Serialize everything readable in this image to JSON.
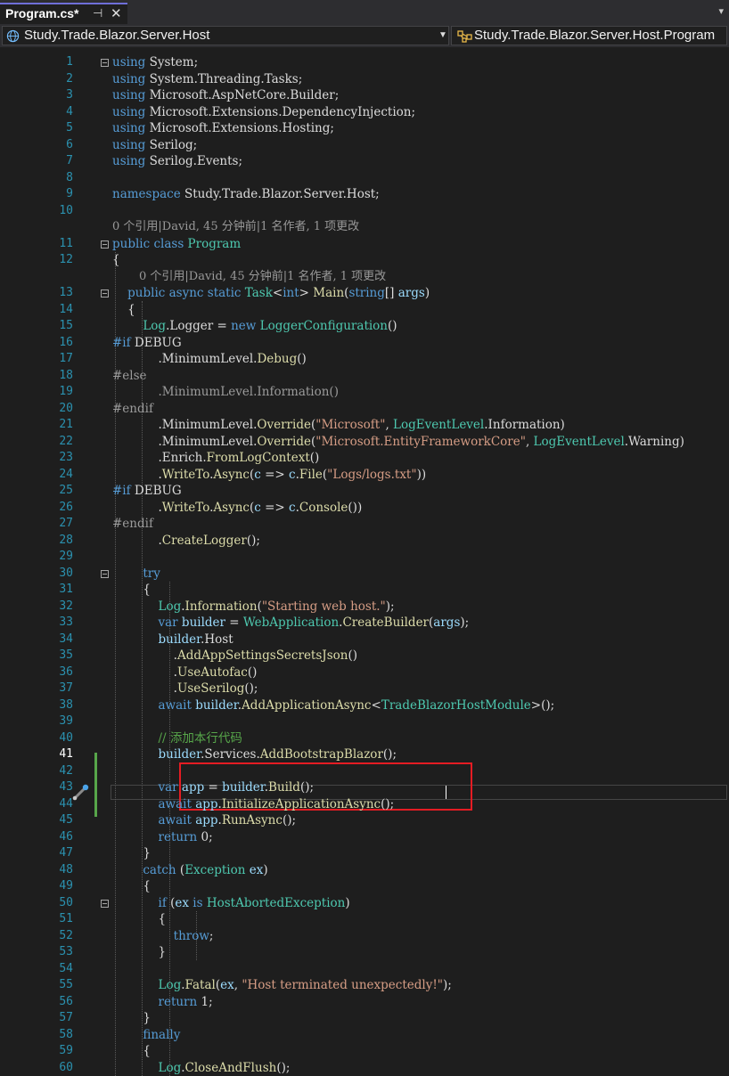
{
  "tab": {
    "title": "Program.cs*"
  },
  "nav": {
    "project": "Study.Trade.Blazor.Server.Host",
    "member": "Study.Trade.Blazor.Server.Host.Program"
  },
  "lenses": [
    "0 个引用|David, 45 分钟前|1 名作者, 1 项更改",
    "0 个引用|David, 45 分钟前|1 名作者, 1 项更改"
  ],
  "lines": [
    {
      "n": "1",
      "t": [
        [
          "k",
          "using"
        ],
        [
          "p",
          " System;"
        ]
      ]
    },
    {
      "n": "2",
      "t": [
        [
          "k",
          "using"
        ],
        [
          "p",
          " System.Threading.Tasks;"
        ]
      ]
    },
    {
      "n": "3",
      "t": [
        [
          "k",
          "using"
        ],
        [
          "p",
          " Microsoft.AspNetCore.Builder;"
        ]
      ]
    },
    {
      "n": "4",
      "t": [
        [
          "k",
          "using"
        ],
        [
          "p",
          " Microsoft.Extensions.DependencyInjection;"
        ]
      ]
    },
    {
      "n": "5",
      "t": [
        [
          "k",
          "using"
        ],
        [
          "p",
          " Microsoft.Extensions.Hosting;"
        ]
      ]
    },
    {
      "n": "6",
      "t": [
        [
          "k",
          "using"
        ],
        [
          "p",
          " Serilog;"
        ]
      ]
    },
    {
      "n": "7",
      "t": [
        [
          "k",
          "using"
        ],
        [
          "p",
          " Serilog.Events;"
        ]
      ]
    },
    {
      "n": "8",
      "t": []
    },
    {
      "n": "9",
      "t": [
        [
          "k",
          "namespace"
        ],
        [
          "p",
          " Study.Trade.Blazor.Server.Host;"
        ]
      ]
    },
    {
      "n": "10",
      "t": []
    },
    {
      "n": "11",
      "t": [
        [
          "k",
          "public class "
        ],
        [
          "t",
          "Program"
        ]
      ]
    },
    {
      "n": "12",
      "t": [
        [
          "p",
          "{"
        ]
      ]
    },
    {
      "n": "13",
      "t": [
        [
          "k",
          "    public async static "
        ],
        [
          "t",
          "Task"
        ],
        [
          "p",
          "<"
        ],
        [
          "k",
          "int"
        ],
        [
          "p",
          "> "
        ],
        [
          "m",
          "Main"
        ],
        [
          "p",
          "("
        ],
        [
          "k",
          "string"
        ],
        [
          "p",
          "[] "
        ],
        [
          "v",
          "args"
        ],
        [
          "p",
          ")"
        ]
      ]
    },
    {
      "n": "14",
      "t": [
        [
          "p",
          "    {"
        ]
      ]
    },
    {
      "n": "15",
      "t": [
        [
          "p",
          "        "
        ],
        [
          "t",
          "Log"
        ],
        [
          "p",
          "."
        ],
        [
          "p",
          "Logger = "
        ],
        [
          "k",
          "new "
        ],
        [
          "t",
          "LoggerConfiguration"
        ],
        [
          "p",
          "()"
        ]
      ]
    },
    {
      "n": "16",
      "t": [
        [
          "k",
          "#if"
        ],
        [
          "p",
          " DEBUG"
        ]
      ]
    },
    {
      "n": "17",
      "t": [
        [
          "p",
          "            ."
        ],
        [
          "p",
          "MinimumLevel."
        ],
        [
          "m",
          "Debug"
        ],
        [
          "p",
          "()"
        ]
      ]
    },
    {
      "n": "18",
      "t": [
        [
          "g",
          "#else"
        ]
      ]
    },
    {
      "n": "19",
      "t": [
        [
          "g",
          "            .MinimumLevel.Information()"
        ]
      ]
    },
    {
      "n": "20",
      "t": [
        [
          "g",
          "#endif"
        ]
      ]
    },
    {
      "n": "21",
      "t": [
        [
          "p",
          "            .MinimumLevel."
        ],
        [
          "m",
          "Override"
        ],
        [
          "p",
          "("
        ],
        [
          "s",
          "\"Microsoft\""
        ],
        [
          "p",
          ", "
        ],
        [
          "t",
          "LogEventLevel"
        ],
        [
          "p",
          ".Information)"
        ]
      ]
    },
    {
      "n": "22",
      "t": [
        [
          "p",
          "            .MinimumLevel."
        ],
        [
          "m",
          "Override"
        ],
        [
          "p",
          "("
        ],
        [
          "s",
          "\"Microsoft.EntityFrameworkCore\""
        ],
        [
          "p",
          ", "
        ],
        [
          "t",
          "LogEventLevel"
        ],
        [
          "p",
          ".Warning)"
        ]
      ]
    },
    {
      "n": "23",
      "t": [
        [
          "p",
          "            .Enrich."
        ],
        [
          "m",
          "FromLogContext"
        ],
        [
          "p",
          "()"
        ]
      ]
    },
    {
      "n": "24",
      "t": [
        [
          "p",
          "            ."
        ],
        [
          "m",
          "WriteTo"
        ],
        [
          "p",
          "."
        ],
        [
          "m",
          "Async"
        ],
        [
          "p",
          "("
        ],
        [
          "v",
          "c"
        ],
        [
          "p",
          " => "
        ],
        [
          "v",
          "c"
        ],
        [
          "p",
          "."
        ],
        [
          "m",
          "File"
        ],
        [
          "p",
          "("
        ],
        [
          "s",
          "\"Logs/logs.txt\""
        ],
        [
          "p",
          "))"
        ]
      ]
    },
    {
      "n": "25",
      "t": [
        [
          "k",
          "#if"
        ],
        [
          "p",
          " DEBUG"
        ]
      ]
    },
    {
      "n": "26",
      "t": [
        [
          "p",
          "            ."
        ],
        [
          "m",
          "WriteTo"
        ],
        [
          "p",
          "."
        ],
        [
          "m",
          "Async"
        ],
        [
          "p",
          "("
        ],
        [
          "v",
          "c"
        ],
        [
          "p",
          " => "
        ],
        [
          "v",
          "c"
        ],
        [
          "p",
          "."
        ],
        [
          "m",
          "Console"
        ],
        [
          "p",
          "())"
        ]
      ]
    },
    {
      "n": "27",
      "t": [
        [
          "g",
          "#endif"
        ]
      ]
    },
    {
      "n": "28",
      "t": [
        [
          "p",
          "            ."
        ],
        [
          "m",
          "CreateLogger"
        ],
        [
          "p",
          "();"
        ]
      ]
    },
    {
      "n": "29",
      "t": []
    },
    {
      "n": "30",
      "t": [
        [
          "k",
          "        try"
        ]
      ]
    },
    {
      "n": "31",
      "t": [
        [
          "p",
          "        {"
        ]
      ]
    },
    {
      "n": "32",
      "t": [
        [
          "p",
          "            "
        ],
        [
          "t",
          "Log"
        ],
        [
          "p",
          "."
        ],
        [
          "m",
          "Information"
        ],
        [
          "p",
          "("
        ],
        [
          "s",
          "\"Starting web host.\""
        ],
        [
          "p",
          ");"
        ]
      ]
    },
    {
      "n": "33",
      "t": [
        [
          "k",
          "            var "
        ],
        [
          "v",
          "builder"
        ],
        [
          "p",
          " = "
        ],
        [
          "t",
          "WebApplication"
        ],
        [
          "p",
          "."
        ],
        [
          "m",
          "CreateBuilder"
        ],
        [
          "p",
          "("
        ],
        [
          "v",
          "args"
        ],
        [
          "p",
          ");"
        ]
      ]
    },
    {
      "n": "34",
      "t": [
        [
          "p",
          "            "
        ],
        [
          "v",
          "builder"
        ],
        [
          "p",
          ".Host"
        ]
      ]
    },
    {
      "n": "35",
      "t": [
        [
          "p",
          "                ."
        ],
        [
          "m",
          "AddAppSettingsSecretsJson"
        ],
        [
          "p",
          "()"
        ]
      ]
    },
    {
      "n": "36",
      "t": [
        [
          "p",
          "                ."
        ],
        [
          "m",
          "UseAutofac"
        ],
        [
          "p",
          "()"
        ]
      ]
    },
    {
      "n": "37",
      "t": [
        [
          "p",
          "                ."
        ],
        [
          "m",
          "UseSerilog"
        ],
        [
          "p",
          "();"
        ]
      ]
    },
    {
      "n": "38",
      "t": [
        [
          "k",
          "            await "
        ],
        [
          "v",
          "builder"
        ],
        [
          "p",
          "."
        ],
        [
          "m",
          "AddApplicationAsync"
        ],
        [
          "p",
          "<"
        ],
        [
          "t",
          "TradeBlazorHostModule"
        ],
        [
          "p",
          ">();"
        ]
      ]
    },
    {
      "n": "39",
      "t": []
    },
    {
      "n": "40",
      "t": [
        [
          "c",
          "            // 添加本行代码"
        ]
      ]
    },
    {
      "n": "41",
      "t": [
        [
          "p",
          "            "
        ],
        [
          "v",
          "builder"
        ],
        [
          "p",
          ".Services."
        ],
        [
          "m",
          "AddBootstrapBlazor"
        ],
        [
          "p",
          "();"
        ]
      ]
    },
    {
      "n": "42",
      "t": []
    },
    {
      "n": "43",
      "t": [
        [
          "k",
          "            var "
        ],
        [
          "v",
          "app"
        ],
        [
          "p",
          " = "
        ],
        [
          "v",
          "builder"
        ],
        [
          "p",
          "."
        ],
        [
          "m",
          "Build"
        ],
        [
          "p",
          "();"
        ]
      ]
    },
    {
      "n": "44",
      "t": [
        [
          "k",
          "            await "
        ],
        [
          "v",
          "app"
        ],
        [
          "p",
          "."
        ],
        [
          "m",
          "InitializeApplicationAsync"
        ],
        [
          "p",
          "();"
        ]
      ]
    },
    {
      "n": "45",
      "t": [
        [
          "k",
          "            await "
        ],
        [
          "v",
          "app"
        ],
        [
          "p",
          "."
        ],
        [
          "m",
          "RunAsync"
        ],
        [
          "p",
          "();"
        ]
      ]
    },
    {
      "n": "46",
      "t": [
        [
          "k",
          "            return "
        ],
        [
          "p",
          "0;"
        ]
      ]
    },
    {
      "n": "47",
      "t": [
        [
          "p",
          "        }"
        ]
      ]
    },
    {
      "n": "48",
      "t": [
        [
          "k",
          "        catch "
        ],
        [
          "p",
          "("
        ],
        [
          "t",
          "Exception"
        ],
        [
          "p",
          " "
        ],
        [
          "v",
          "ex"
        ],
        [
          "p",
          ")"
        ]
      ]
    },
    {
      "n": "49",
      "t": [
        [
          "p",
          "        {"
        ]
      ]
    },
    {
      "n": "50",
      "t": [
        [
          "k",
          "            if "
        ],
        [
          "p",
          "("
        ],
        [
          "v",
          "ex"
        ],
        [
          "k",
          " is "
        ],
        [
          "t",
          "HostAbortedException"
        ],
        [
          "p",
          ")"
        ]
      ]
    },
    {
      "n": "51",
      "t": [
        [
          "p",
          "            {"
        ]
      ]
    },
    {
      "n": "52",
      "t": [
        [
          "k",
          "                throw"
        ],
        [
          "p",
          ";"
        ]
      ]
    },
    {
      "n": "53",
      "t": [
        [
          "p",
          "            }"
        ]
      ]
    },
    {
      "n": "54",
      "t": []
    },
    {
      "n": "55",
      "t": [
        [
          "p",
          "            "
        ],
        [
          "t",
          "Log"
        ],
        [
          "p",
          "."
        ],
        [
          "m",
          "Fatal"
        ],
        [
          "p",
          "("
        ],
        [
          "v",
          "ex"
        ],
        [
          "p",
          ", "
        ],
        [
          "s",
          "\"Host terminated unexpectedly!\""
        ],
        [
          "p",
          ");"
        ]
      ]
    },
    {
      "n": "56",
      "t": [
        [
          "k",
          "            return "
        ],
        [
          "p",
          "1;"
        ]
      ]
    },
    {
      "n": "57",
      "t": [
        [
          "p",
          "        }"
        ]
      ]
    },
    {
      "n": "58",
      "t": [
        [
          "k",
          "        finally"
        ]
      ]
    },
    {
      "n": "59",
      "t": [
        [
          "p",
          "        {"
        ]
      ]
    },
    {
      "n": "60",
      "t": [
        [
          "p",
          "            "
        ],
        [
          "t",
          "Log"
        ],
        [
          "p",
          "."
        ],
        [
          "m",
          "CloseAndFlush"
        ],
        [
          "p",
          "();"
        ]
      ]
    }
  ]
}
